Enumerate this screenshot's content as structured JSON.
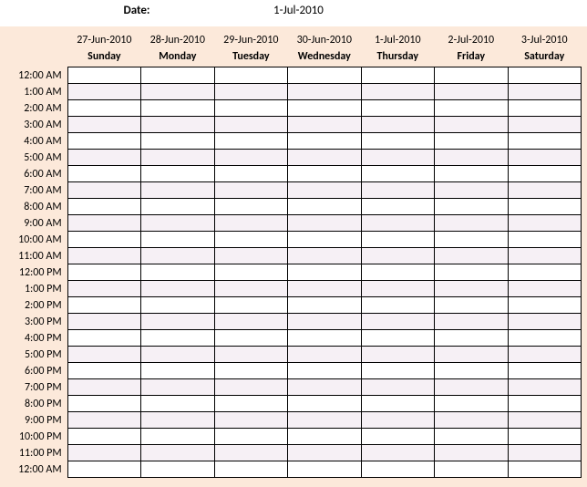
{
  "header": {
    "date_label": "Date:",
    "date_value": "1-Jul-2010"
  },
  "columns": [
    {
      "date": "27-Jun-2010",
      "day": "Sunday"
    },
    {
      "date": "28-Jun-2010",
      "day": "Monday"
    },
    {
      "date": "29-Jun-2010",
      "day": "Tuesday"
    },
    {
      "date": "30-Jun-2010",
      "day": "Wednesday"
    },
    {
      "date": "1-Jul-2010",
      "day": "Thursday"
    },
    {
      "date": "2-Jul-2010",
      "day": "Friday"
    },
    {
      "date": "3-Jul-2010",
      "day": "Saturday"
    }
  ],
  "times": [
    "12:00 AM",
    "1:00 AM",
    "2:00 AM",
    "3:00 AM",
    "4:00 AM",
    "5:00 AM",
    "6:00 AM",
    "7:00 AM",
    "8:00 AM",
    "9:00 AM",
    "10:00 AM",
    "11:00 AM",
    "12:00 PM",
    "1:00 PM",
    "2:00 PM",
    "3:00 PM",
    "4:00 PM",
    "5:00 PM",
    "6:00 PM",
    "7:00 PM",
    "8:00 PM",
    "9:00 PM",
    "10:00 PM",
    "11:00 PM",
    "12:00 AM"
  ]
}
